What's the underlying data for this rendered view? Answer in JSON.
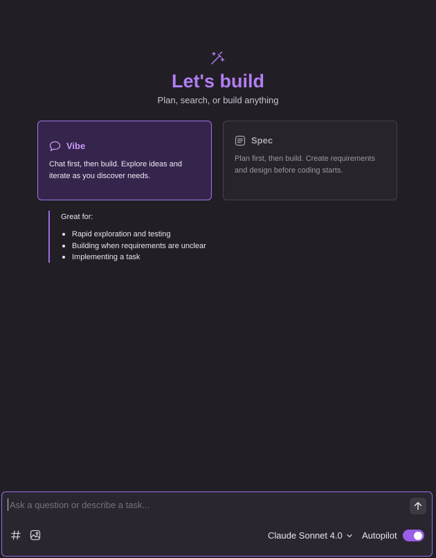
{
  "colors": {
    "background": "#211e25",
    "accent": "#b27ef2",
    "accent_border": "#a277e8",
    "toggle_on": "#9b5ee8"
  },
  "hero": {
    "icon": "magic-wand-icon",
    "title": "Let's build",
    "subtitle": "Plan, search, or build anything"
  },
  "modes": [
    {
      "icon": "chat-bubble-icon",
      "label": "Vibe",
      "description": "Chat first, then build. Explore ideas and iterate as you discover needs.",
      "selected": true
    },
    {
      "icon": "document-lines-icon",
      "label": "Spec",
      "description": "Plan first, then build. Create requirements and design before coding starts.",
      "selected": false
    }
  ],
  "great_for": {
    "heading": "Great for:",
    "items": [
      "Rapid exploration and testing",
      "Building when requirements are unclear",
      "Implementing a task"
    ]
  },
  "composer": {
    "placeholder": "Ask a question or describe a task...",
    "value": "",
    "send_icon": "arrow-up-icon",
    "context_icon": "hash-icon",
    "image_icon": "image-icon",
    "model": "Claude Sonnet 4.0",
    "model_icon": "chevron-down-icon",
    "autopilot_label": "Autopilot",
    "autopilot_on": true
  }
}
